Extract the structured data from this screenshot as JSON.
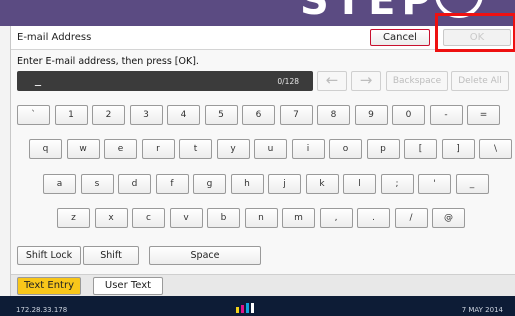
{
  "banner": {
    "text": "STEP"
  },
  "dialog": {
    "title": "E-mail Address",
    "cancel_label": "Cancel",
    "ok_label": "OK",
    "instruction": "Enter E-mail address, then press [OK].",
    "entry_value": "_",
    "char_counter": "0/128"
  },
  "function_keys": {
    "left_arrow": "←",
    "right_arrow": "→",
    "backspace": "Backspace",
    "delete_all": "Delete All"
  },
  "keyboard": {
    "row1": [
      "`",
      "1",
      "2",
      "3",
      "4",
      "5",
      "6",
      "7",
      "8",
      "9",
      "0",
      "-",
      "="
    ],
    "row2": [
      "q",
      "w",
      "e",
      "r",
      "t",
      "y",
      "u",
      "i",
      "o",
      "p",
      "[",
      "]",
      "\\"
    ],
    "row3": [
      "a",
      "s",
      "d",
      "f",
      "g",
      "h",
      "j",
      "k",
      "l",
      ";",
      "'",
      "_"
    ],
    "row4": [
      "z",
      "x",
      "c",
      "v",
      "b",
      "n",
      "m",
      ",",
      ".",
      "/",
      "@"
    ]
  },
  "bottom_keys": {
    "shift_lock": "Shift Lock",
    "shift": "Shift",
    "space": "Space"
  },
  "tabs": {
    "text_entry": "Text Entry",
    "user_text": "User Text"
  },
  "status": {
    "ip": "172.28.33.178",
    "date": "7 MAY  2014"
  },
  "colors": {
    "accent_tab": "#f8c61a",
    "highlight": "#ee1111",
    "status_bg": "#0d1c36",
    "banner": "#5b4b82"
  }
}
